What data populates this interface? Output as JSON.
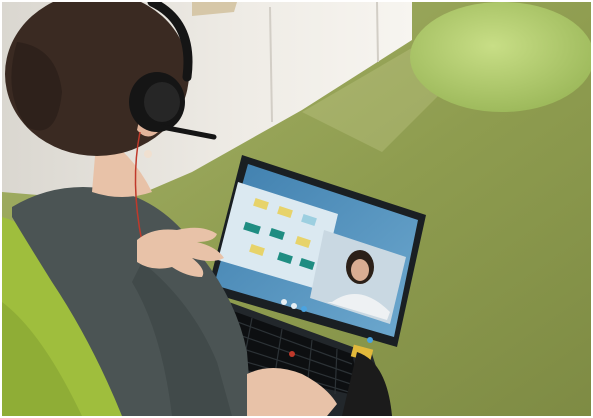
{
  "scene": {
    "subject": "person-with-headset-on-video-call",
    "device": "laptop",
    "screen_content": {
      "left_pane": "diagram-flowchart",
      "right_pane": "video-participant"
    }
  },
  "colors": {
    "carpet": "#9aa65a",
    "carpet_dark": "#7f8f45",
    "wall": "#e9e6e0",
    "pouf": "#b5cf6e",
    "chair": "#9fbe3d",
    "sweater": "#4b5454",
    "hair": "#3a2a22",
    "skin": "#e8c2a8",
    "headset": "#151515",
    "laptop": "#1d2226",
    "screen_blue": "#4d8fb8",
    "note_yellow": "#e7d36a",
    "note_teal": "#1f8d82",
    "call_bg": "#c9d8e2"
  }
}
